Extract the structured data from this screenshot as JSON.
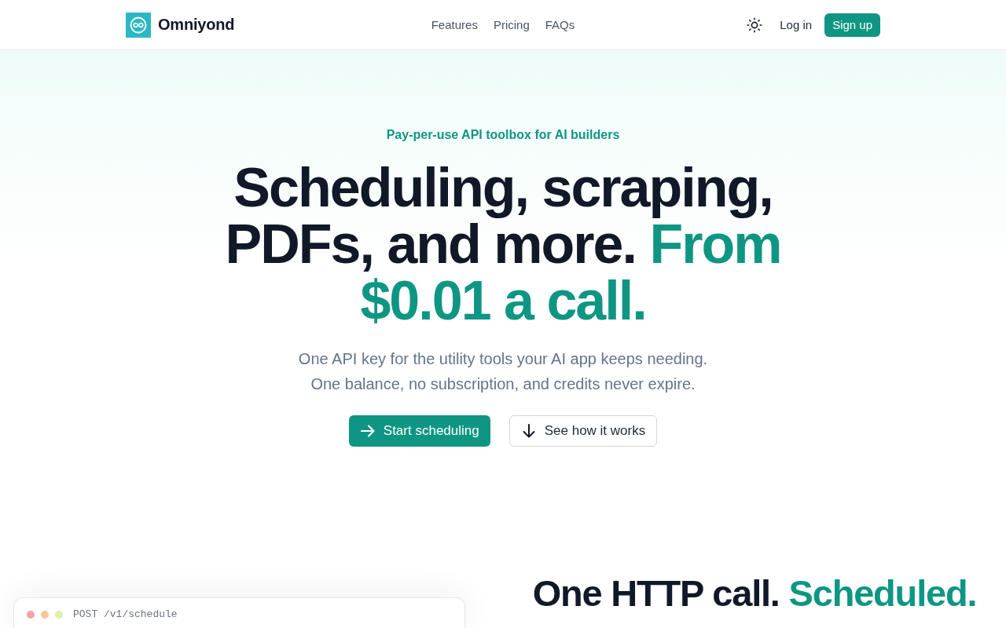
{
  "nav": {
    "brand": "Omniyond",
    "links": [
      {
        "label": "Features"
      },
      {
        "label": "Pricing"
      },
      {
        "label": "FAQs"
      }
    ],
    "login": "Log in",
    "signup": "Sign up"
  },
  "hero": {
    "eyebrow": "Pay-per-use API toolbox for AI builders",
    "headline": [
      {
        "text": "Scheduling, scraping, PDFs, and more.",
        "accent": false
      },
      {
        "text": "From $0.01 a call.",
        "accent": true
      }
    ],
    "subtitle": "One API key for the utility tools your AI app keeps needing. One balance, no subscription, and credits never expire.",
    "buttons": [
      {
        "label": "Start scheduling",
        "kind": "primary"
      },
      {
        "label": "See how it works",
        "kind": "secondary"
      }
    ]
  },
  "demo": {
    "request": "POST /v1/schedule",
    "heading": [
      {
        "text": "One HTTP call.",
        "accent": false
      },
      {
        "text": "Scheduled.",
        "accent": true
      }
    ]
  }
}
